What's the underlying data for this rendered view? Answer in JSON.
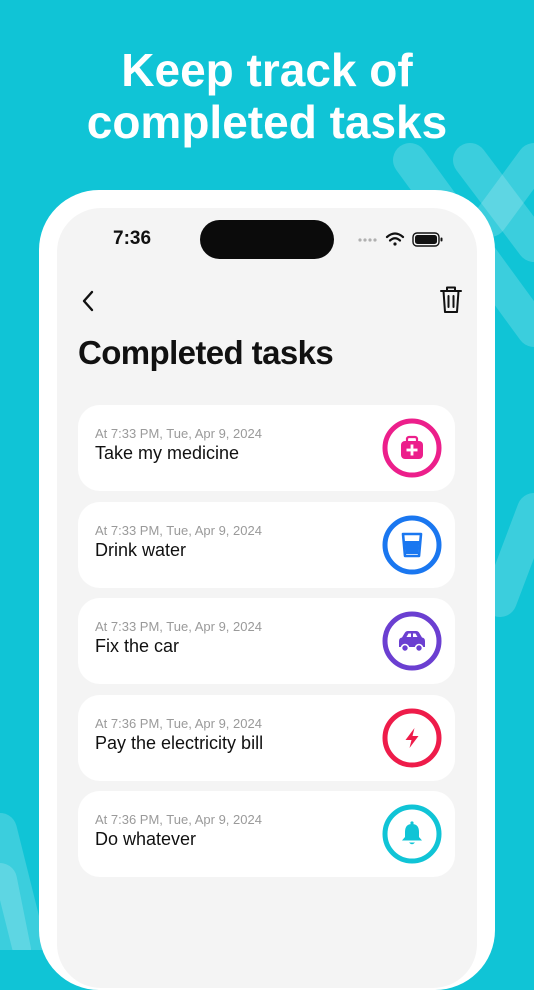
{
  "headline": {
    "line1": "Keep track of",
    "line2": "completed tasks"
  },
  "status_bar": {
    "time": "7:36"
  },
  "page": {
    "title": "Completed tasks"
  },
  "colors": {
    "background": "#10c4d6",
    "medicine": "#ec1f8b",
    "water": "#1a77f0",
    "car": "#6b3fd1",
    "electricity": "#ee1c4a",
    "whatever": "#10c4d6"
  },
  "tasks": [
    {
      "time": "At 7:33 PM, Tue, Apr 9, 2024",
      "title": "Take my medicine",
      "icon": "first-aid-kit-icon",
      "color": "#ec1f8b"
    },
    {
      "time": "At 7:33 PM, Tue, Apr 9, 2024",
      "title": "Drink water",
      "icon": "glass-of-water-icon",
      "color": "#1a77f0"
    },
    {
      "time": "At 7:33 PM, Tue, Apr 9, 2024",
      "title": "Fix the car",
      "icon": "car-icon",
      "color": "#6b3fd1"
    },
    {
      "time": "At 7:36 PM, Tue, Apr 9, 2024",
      "title": "Pay the electricity bill",
      "icon": "lightning-bolt-icon",
      "color": "#ee1c4a"
    },
    {
      "time": "At 7:36 PM, Tue, Apr 9, 2024",
      "title": "Do whatever",
      "icon": "bell-icon",
      "color": "#10c4d6"
    }
  ]
}
